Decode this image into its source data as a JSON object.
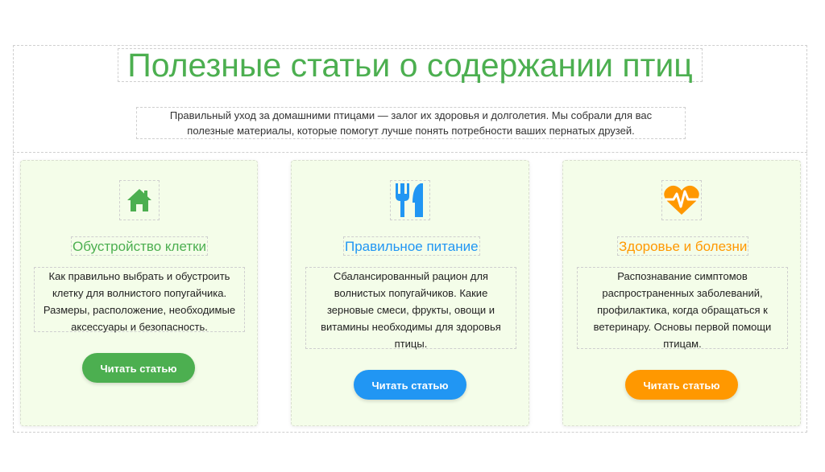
{
  "header": {
    "title": "Полезные статьи о содержании птиц",
    "intro_line1": "Правильный уход за домашними птицами — залог их здоровья и долголетия. Мы собрали для вас",
    "intro_line2": "полезные материалы, которые помогут лучше понять потребности ваших пернатых друзей."
  },
  "cards": [
    {
      "icon": "home-icon",
      "title": "Обустройство клетки",
      "text": [
        "Как правильно выбрать и обустроить",
        "клетку для волнистого попугайчика.",
        "Размеры, расположение, необходимые",
        "аксессуары и безопасность."
      ],
      "button": "Читать статью",
      "color": "#4caf50"
    },
    {
      "icon": "utensils-icon",
      "title": "Правильное питание",
      "text": [
        "Сбалансированный рацион для",
        "волнистых попугайчиков. Какие",
        "зерновые смеси, фрукты, овощи и",
        "витамины необходимы для здоровья",
        "птицы."
      ],
      "button": "Читать статью",
      "color": "#2196f3"
    },
    {
      "icon": "heartbeat-icon",
      "title": "Здоровье и болезни",
      "text": [
        "Распознавание симптомов",
        "распространенных заболеваний,",
        "профилактика, когда обращаться к",
        "ветеринару. Основы первой помощи",
        "птицам."
      ],
      "button": "Читать статью",
      "color": "#ff9800"
    }
  ]
}
